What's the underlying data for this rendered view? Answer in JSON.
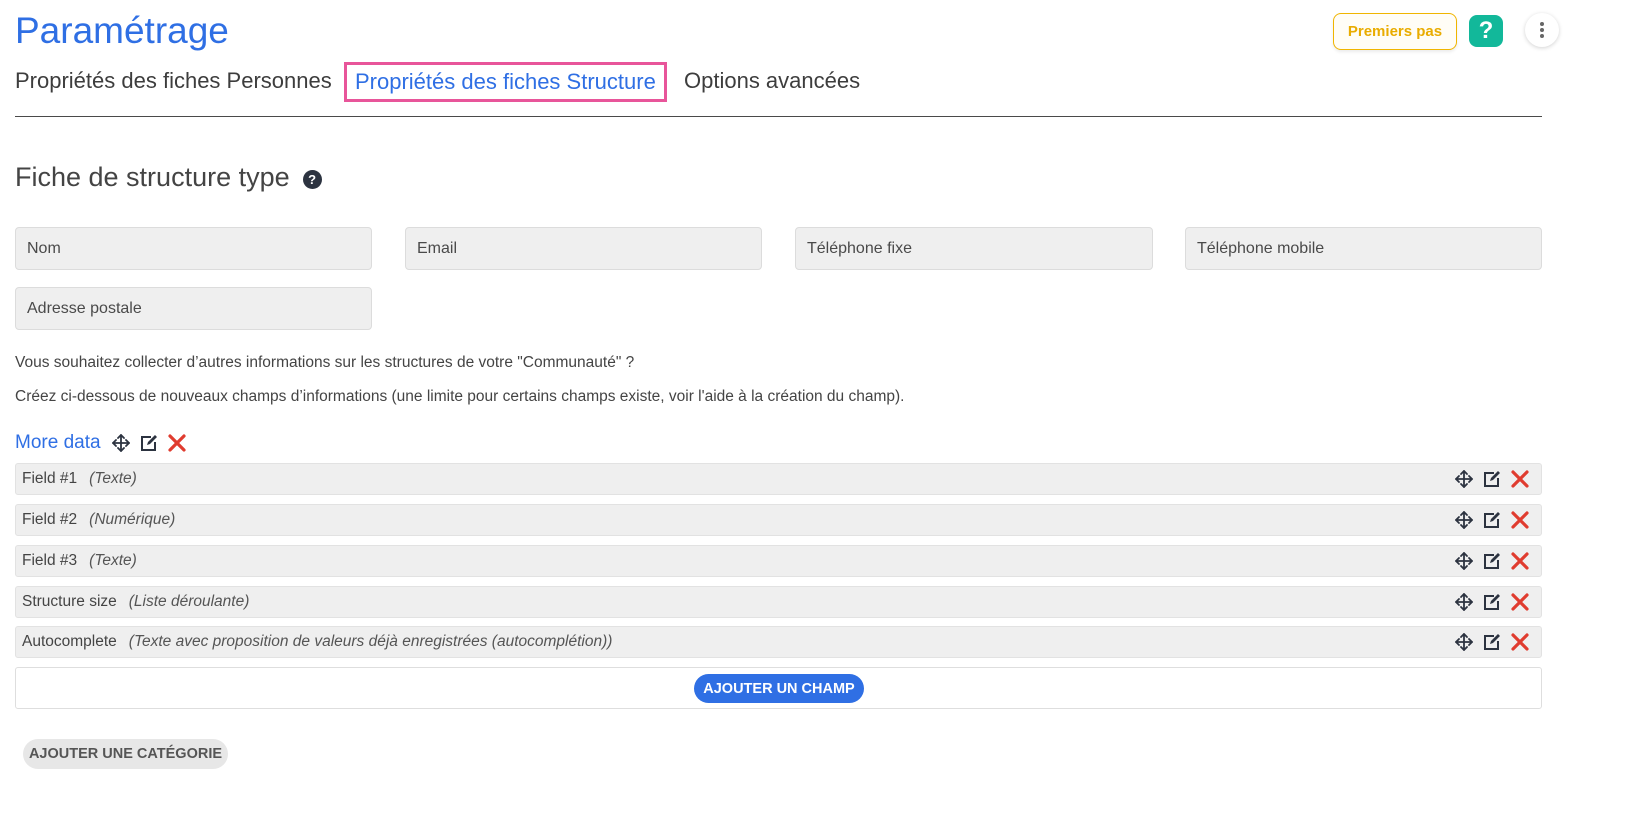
{
  "header": {
    "title": "Paramétrage",
    "premiers_pas_label": "Premiers pas",
    "help_label": "?",
    "help_color": "#12b89a",
    "accent_color": "#2f6fe4",
    "tab_highlight_color": "#e8559a"
  },
  "tabs": [
    {
      "label": "Propriétés des fiches Personnes",
      "active": false
    },
    {
      "label": "Propriétés des fiches Structure",
      "active": true
    },
    {
      "label": "Options avancées",
      "active": false
    }
  ],
  "section": {
    "title": "Fiche de structure type",
    "help_icon": "?"
  },
  "default_fields": [
    "Nom",
    "Email",
    "Téléphone fixe",
    "Téléphone mobile",
    "Adresse postale"
  ],
  "info": {
    "line1": "Vous souhaitez collecter d’autres informations sur les structures de votre \"Communauté\" ?",
    "line2": "Créez ci-dessous de nouveaux champs d’informations (une limite pour certains champs existe, voir l'aide à la création du champ)."
  },
  "category": {
    "name": "More data",
    "fields": [
      {
        "name": "Field #1",
        "type": "(Texte)"
      },
      {
        "name": "Field #2",
        "type": "(Numérique)"
      },
      {
        "name": "Field #3",
        "type": "(Texte)"
      },
      {
        "name": "Structure size",
        "type": "(Liste déroulante)"
      },
      {
        "name": "Autocomplete",
        "type": "(Texte avec proposition de valeurs déjà enregistrées (autocomplétion))"
      }
    ],
    "add_field_label": "AJOUTER UN CHAMP"
  },
  "add_category_label": "AJOUTER UNE CATÉGORIE",
  "icons": {
    "move": "move-icon",
    "edit": "edit-icon",
    "delete": "delete-icon",
    "delete_color": "#e03c2f"
  }
}
